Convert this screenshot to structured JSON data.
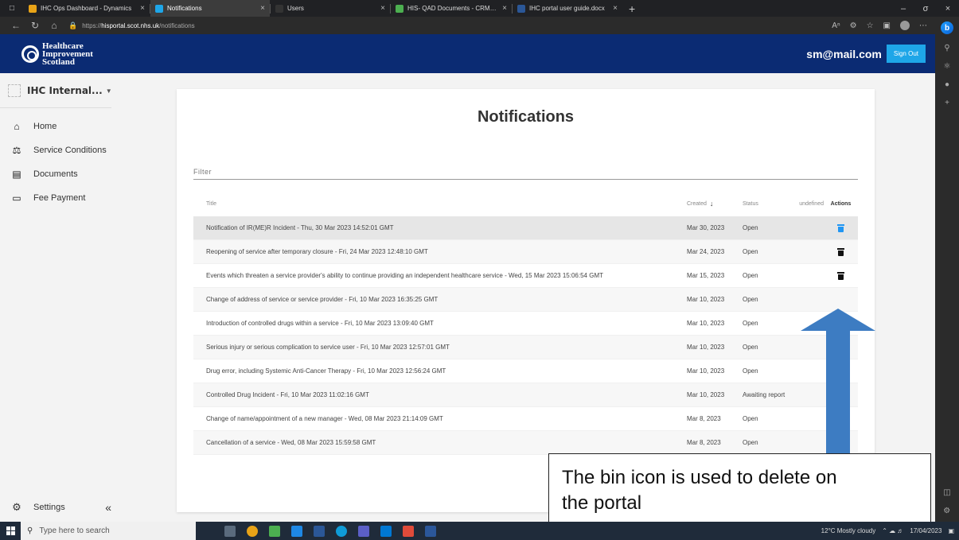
{
  "browser": {
    "tabs": [
      {
        "title": "IHC Ops Dashboard - Dynamics",
        "favicon_color": "#e8a317",
        "active": false
      },
      {
        "title": "Notifications",
        "favicon_color": "#1ea6e8",
        "active": true
      },
      {
        "title": "Users",
        "favicon_color": "#333333",
        "active": false
      },
      {
        "title": "HIS- QAD Documents - CRM Hel",
        "favicon_color": "#4caf50",
        "active": false
      },
      {
        "title": "IHC portal user guide.docx",
        "favicon_color": "#2b5797",
        "active": false
      }
    ],
    "new_tab": "+",
    "url_prefix": "https://",
    "url_host": "hisportal.scot.nhs.uk",
    "url_path": "/notifications"
  },
  "header": {
    "logo_line1": "Healthcare",
    "logo_line2": "Improvement",
    "logo_line3": "Scotland",
    "user_email": "sm@mail.com",
    "signout_label": "Sign Out"
  },
  "sidebar": {
    "org_name": "IHC Internal...",
    "items": [
      {
        "label": "Home",
        "icon": "home-icon",
        "glyph": "⌂"
      },
      {
        "label": "Service Conditions",
        "icon": "gavel-icon",
        "glyph": "⚖"
      },
      {
        "label": "Documents",
        "icon": "document-icon",
        "glyph": "▤"
      },
      {
        "label": "Fee Payment",
        "icon": "card-icon",
        "glyph": "▭"
      }
    ],
    "settings_label": "Settings",
    "collapse_label": "«"
  },
  "main": {
    "title": "Notifications",
    "filter_placeholder": "Filter",
    "columns": {
      "title": "Title",
      "created": "Created",
      "status": "Status",
      "undefined": "undefined",
      "actions": "Actions"
    },
    "rows": [
      {
        "title": "Notification of IR(ME)R Incident - Thu, 30 Mar 2023 14:52:01 GMT",
        "created": "Mar 30, 2023",
        "status": "Open",
        "bin": "blue"
      },
      {
        "title": "Reopening of service after temporary closure - Fri, 24 Mar 2023 12:48:10 GMT",
        "created": "Mar 24, 2023",
        "status": "Open",
        "bin": "black"
      },
      {
        "title": "Events which threaten a service provider's ability to continue providing an independent healthcare service - Wed, 15 Mar 2023 15:06:54 GMT",
        "created": "Mar 15, 2023",
        "status": "Open",
        "bin": "black"
      },
      {
        "title": "Change of address of service or service provider - Fri, 10 Mar 2023 16:35:25 GMT",
        "created": "Mar 10, 2023",
        "status": "Open",
        "bin": ""
      },
      {
        "title": "Introduction of controlled drugs within a service - Fri, 10 Mar 2023 13:09:40 GMT",
        "created": "Mar 10, 2023",
        "status": "Open",
        "bin": ""
      },
      {
        "title": "Serious injury or serious complication to service user - Fri, 10 Mar 2023 12:57:01 GMT",
        "created": "Mar 10, 2023",
        "status": "Open",
        "bin": ""
      },
      {
        "title": "Drug error, including Systemic Anti-Cancer Therapy - Fri, 10 Mar 2023 12:56:24 GMT",
        "created": "Mar 10, 2023",
        "status": "Open",
        "bin": ""
      },
      {
        "title": "Controlled Drug Incident - Fri, 10 Mar 2023 11:02:16 GMT",
        "created": "Mar 10, 2023",
        "status": "Awaiting report",
        "bin": ""
      },
      {
        "title": "Change of name/appointment of a new manager - Wed, 08 Mar 2023 21:14:09 GMT",
        "created": "Mar 8, 2023",
        "status": "Open",
        "bin": ""
      },
      {
        "title": "Cancellation of a service - Wed, 08 Mar 2023 15:59:58 GMT",
        "created": "Mar 8, 2023",
        "status": "Open",
        "bin": ""
      }
    ]
  },
  "annotation": {
    "line1": "The bin icon is used to delete on",
    "line2": "the portal",
    "arrow_color": "#3d7cc2"
  },
  "taskbar": {
    "search_placeholder": "Type here to search",
    "weather": "12°C  Mostly cloudy",
    "date": "17/04/2023"
  }
}
